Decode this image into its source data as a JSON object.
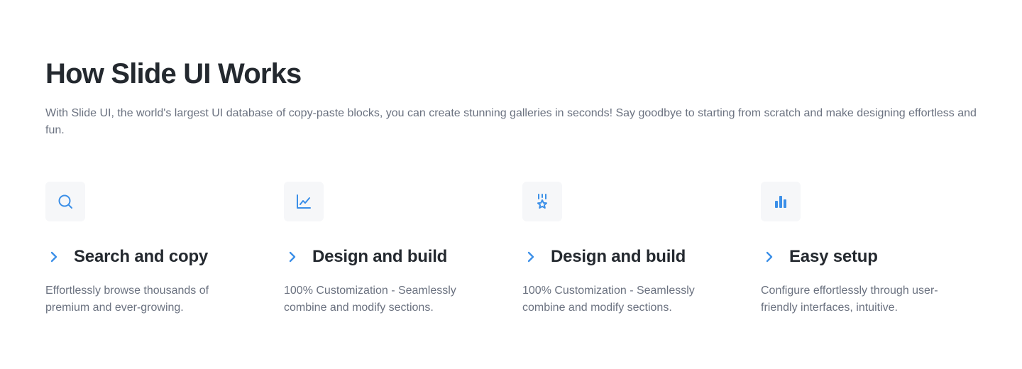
{
  "section": {
    "title": "How Slide UI Works",
    "description": "With Slide UI, the world's largest UI database of copy-paste blocks, you can create stunning galleries in seconds! Say goodbye to starting from scratch and make designing effortless and fun."
  },
  "colors": {
    "accent": "#3b8fe8",
    "icon_bg": "#f6f7f9",
    "heading": "#24292f",
    "body": "#6b7280"
  },
  "features": [
    {
      "icon": "search-icon",
      "title": "Search and copy",
      "description": "Effortlessly browse thousands of premium and ever-growing."
    },
    {
      "icon": "line-chart-icon",
      "title": "Design and build",
      "description": "100% Customization - Seamlessly combine and modify sections."
    },
    {
      "icon": "award-star-icon",
      "title": "Design and build",
      "description": "100% Customization - Seamlessly combine and modify sections."
    },
    {
      "icon": "bar-chart-icon",
      "title": "Easy setup",
      "description": "Configure effortlessly through user-friendly interfaces, intuitive."
    }
  ]
}
